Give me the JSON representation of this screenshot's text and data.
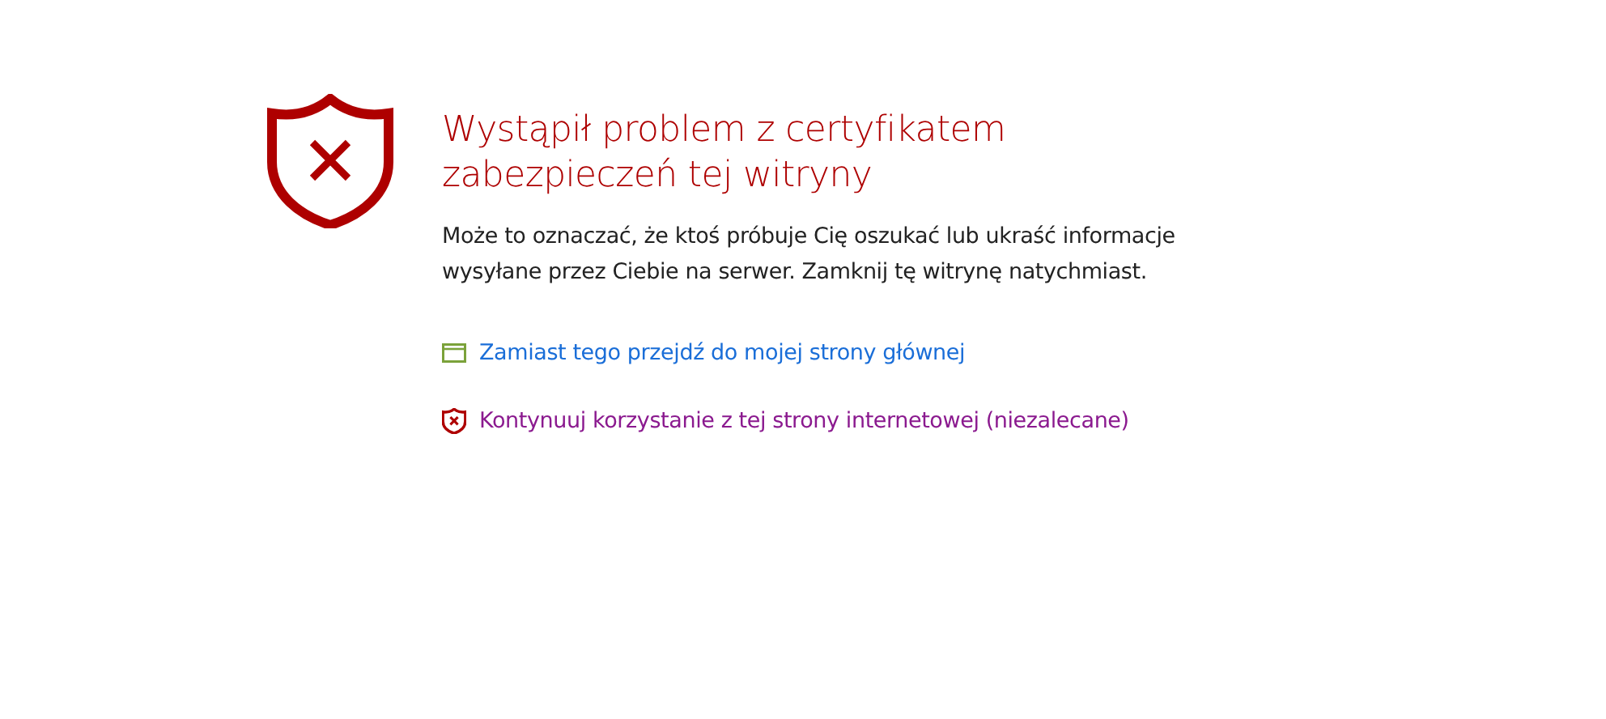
{
  "title": "Wystąpił problem z certyfikatem zabezpieczeń tej witryny",
  "message": "Może to oznaczać, że ktoś próbuje Cię oszukać lub ukraść informacje wysyłane przez Ciebie na serwer. Zamknij tę witrynę natychmiast.",
  "links": [
    {
      "kind": "home",
      "label": "Zamiast tego przejdź do mojej strony głównej"
    },
    {
      "kind": "continue",
      "label": "Kontynuuj korzystanie z tej strony internetowej (niezalecane)"
    }
  ]
}
